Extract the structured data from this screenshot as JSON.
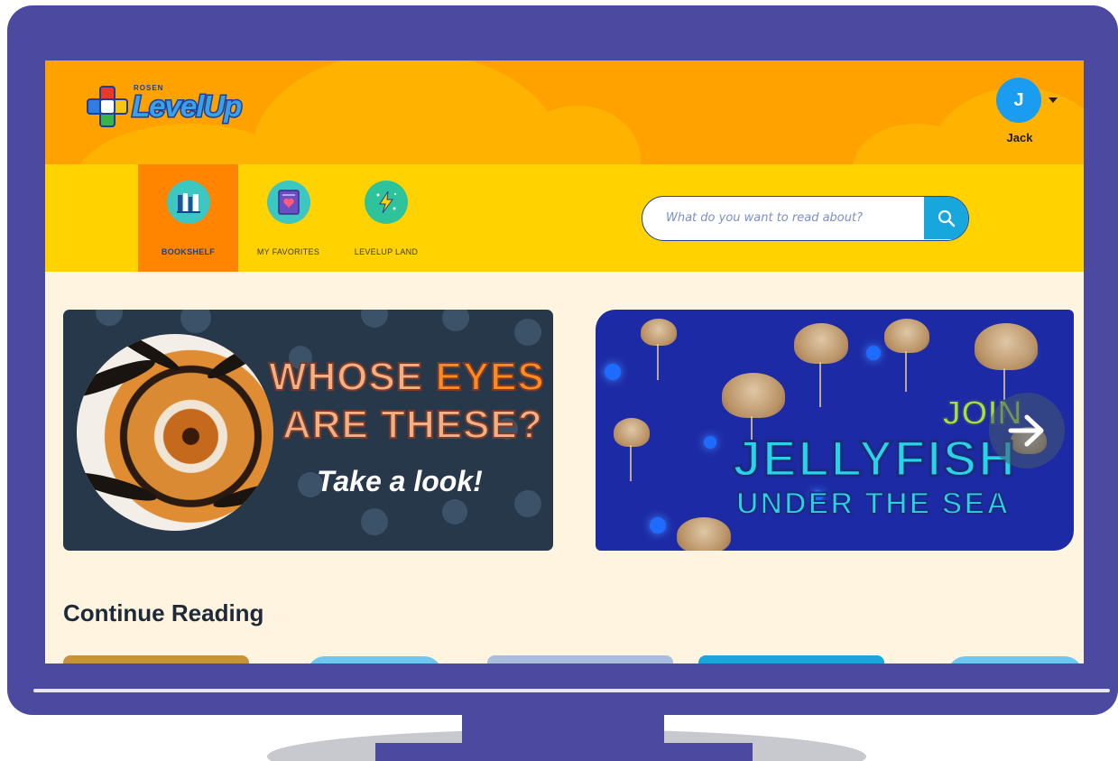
{
  "header": {
    "logo_small": "ROSEN",
    "logo_text": "LevelUp",
    "user": {
      "initial": "J",
      "name": "Jack"
    }
  },
  "nav": {
    "items": [
      {
        "label": "BOOKSHELF",
        "icon": "bookshelf-icon",
        "active": true
      },
      {
        "label": "MY FAVORITES",
        "icon": "favorites-book-icon",
        "active": false
      },
      {
        "label": "LEVELUP LAND",
        "icon": "lightning-icon",
        "active": false
      }
    ]
  },
  "search": {
    "placeholder": "What do you want to read about?",
    "icon": "search-icon"
  },
  "banners": [
    {
      "line1_a": "WHOSE ",
      "line1_b": "EYES",
      "line2": "ARE THESE?",
      "subtitle": "Take a look!"
    },
    {
      "kicker": "JOIN",
      "title": "JELLYFISH",
      "subtitle": "UNDER THE SEA"
    }
  ],
  "carousel": {
    "next_icon": "arrow-right-icon"
  },
  "sections": {
    "continue_reading": "Continue Reading"
  },
  "colors": {
    "monitor": "#4b49a0",
    "header": "#ffa200",
    "nav": "#ffd200",
    "nav_active": "#ff8400",
    "page_bg": "#fff4e0",
    "accent": "#17a7dc"
  }
}
